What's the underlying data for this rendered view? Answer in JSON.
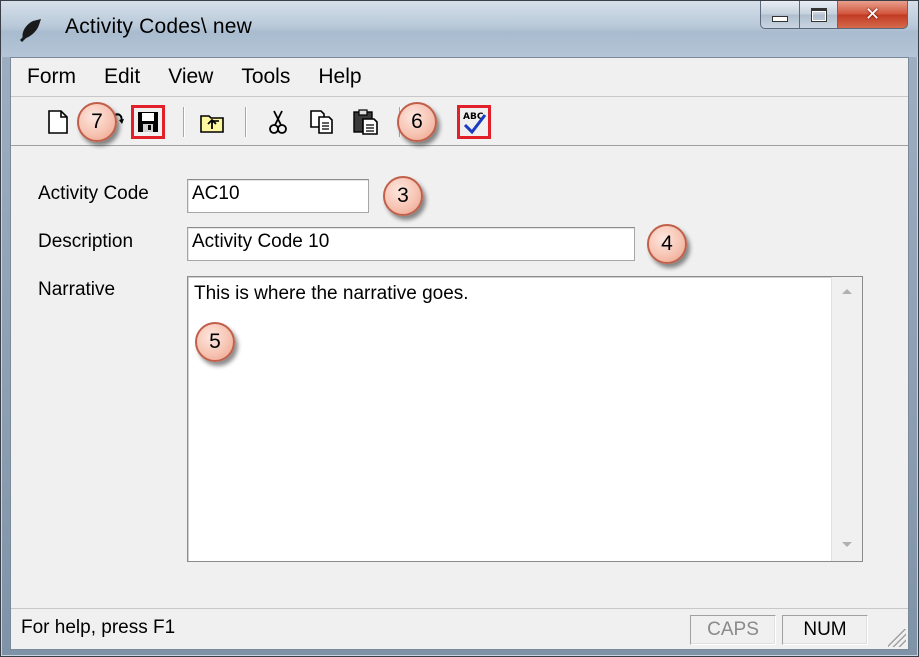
{
  "window": {
    "title": "Activity Codes\\ new"
  },
  "menu": [
    "Form",
    "Edit",
    "View",
    "Tools",
    "Help"
  ],
  "toolbar": {
    "buttons": [
      {
        "icon": "new-document-icon"
      },
      {
        "icon": "open-icon"
      },
      {
        "icon": "save-icon",
        "highlighted": true
      },
      {
        "icon": "up-folder-icon"
      },
      {
        "icon": "cut-icon"
      },
      {
        "icon": "copy-icon"
      },
      {
        "icon": "paste-icon"
      },
      {
        "icon": "spell-check-icon",
        "highlighted": true,
        "glyph_text": "ABC"
      }
    ]
  },
  "callouts": {
    "toolbar_new": "7",
    "toolbar_paste": "6",
    "activity_code": "3",
    "description": "4",
    "narrative": "5"
  },
  "form": {
    "activity_code": {
      "label": "Activity Code",
      "value": "AC10"
    },
    "description": {
      "label": "Description",
      "value": "Activity Code 10"
    },
    "narrative": {
      "label": "Narrative",
      "value": "This is where the narrative goes."
    }
  },
  "status": {
    "help_text": "For help, press F1",
    "caps": "CAPS",
    "num": "NUM"
  },
  "colors": {
    "highlight_border": "#e2202a",
    "callout_fill": "#f7c4b3",
    "caps_disabled_text": "#8a8a8a"
  }
}
